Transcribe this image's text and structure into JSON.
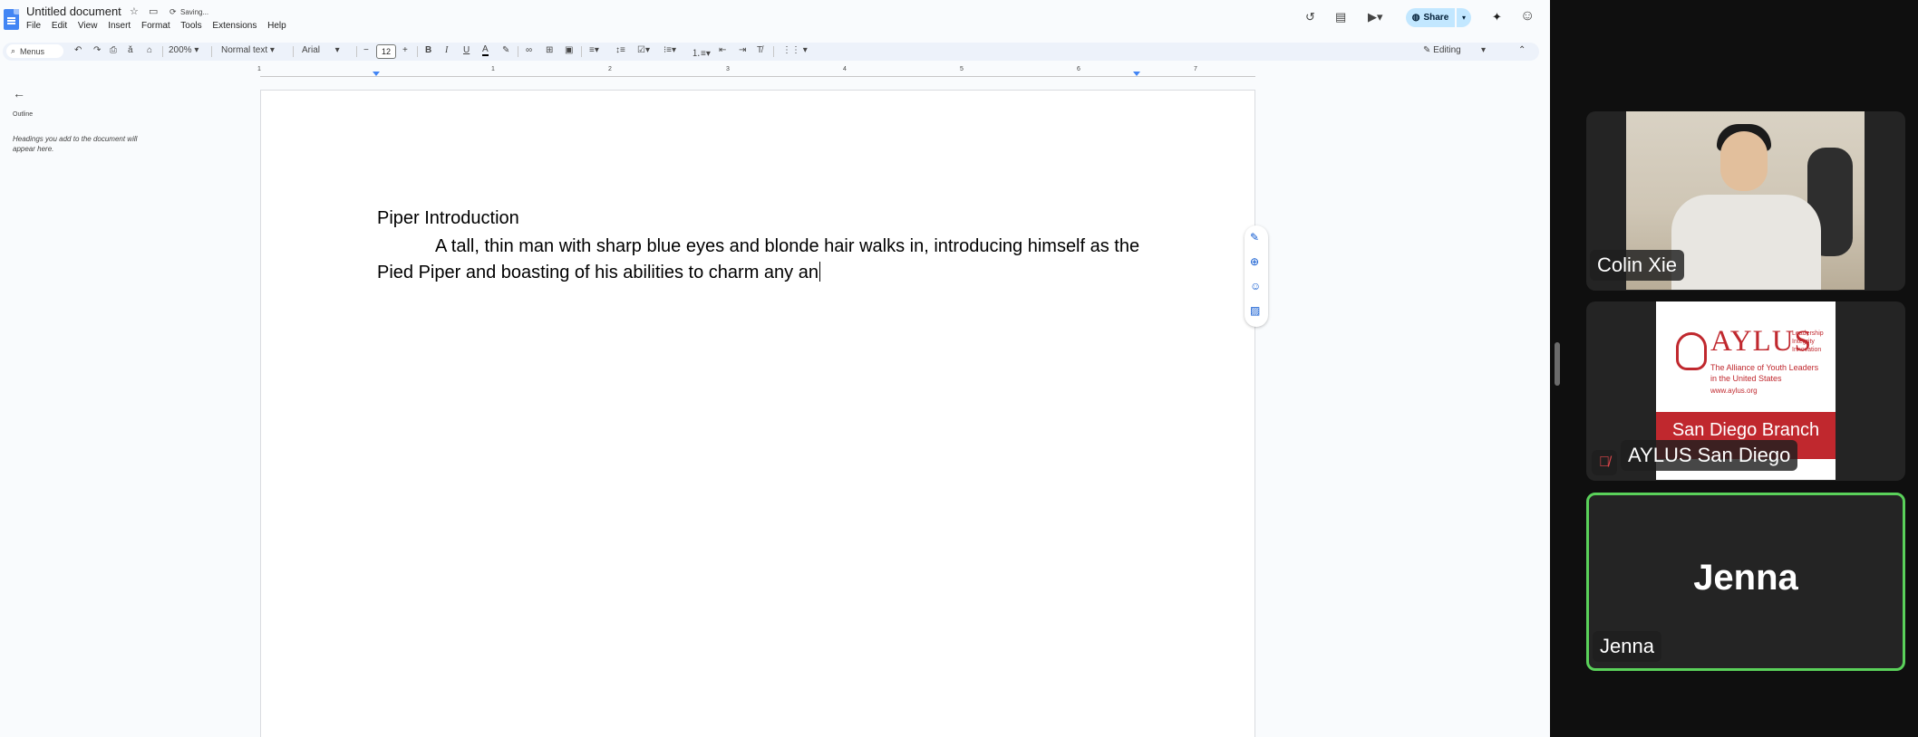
{
  "docs": {
    "title": "Untitled document",
    "status": "Saving...",
    "menu": [
      "File",
      "Edit",
      "View",
      "Insert",
      "Format",
      "Tools",
      "Extensions",
      "Help"
    ],
    "share_label": "Share",
    "toolbar": {
      "search": "Menus",
      "zoom": "200%",
      "style": "Normal text",
      "font": "Arial",
      "font_size": "12",
      "mode": "Editing"
    },
    "ruler_numbers": [
      "1",
      "1",
      "2",
      "3",
      "4",
      "5",
      "6",
      "7"
    ],
    "outline": {
      "label": "Outline",
      "hint": "Headings you add to the document will appear here."
    },
    "document": {
      "heading": "Piper Introduction",
      "body": "A tall, thin man with sharp blue eyes and blonde hair walks in, introducing himself as the Pied Piper and boasting of his abilities to charm any an"
    }
  },
  "participants": [
    {
      "name": "Colin Xie",
      "muted": false,
      "active": false
    },
    {
      "name": "AYLUS San Diego",
      "muted": true,
      "active": false
    },
    {
      "name": "Jenna",
      "muted": false,
      "active": true
    }
  ],
  "aylus_logo": {
    "word": "AYLUS",
    "tagline": [
      "Leadership",
      "Integrity",
      "Innovation"
    ],
    "org_line1": "The Alliance of Youth Leaders",
    "org_line2": "in the United States",
    "url": "www.aylus.org",
    "branch": "San Diego Branch"
  },
  "jenna_tile": {
    "center_name": "Jenna"
  },
  "colors": {
    "accent": "#0b57d0",
    "share_bg": "#c2e7ff",
    "active_border": "#5ad15a",
    "aylus_red": "#c0282e"
  }
}
